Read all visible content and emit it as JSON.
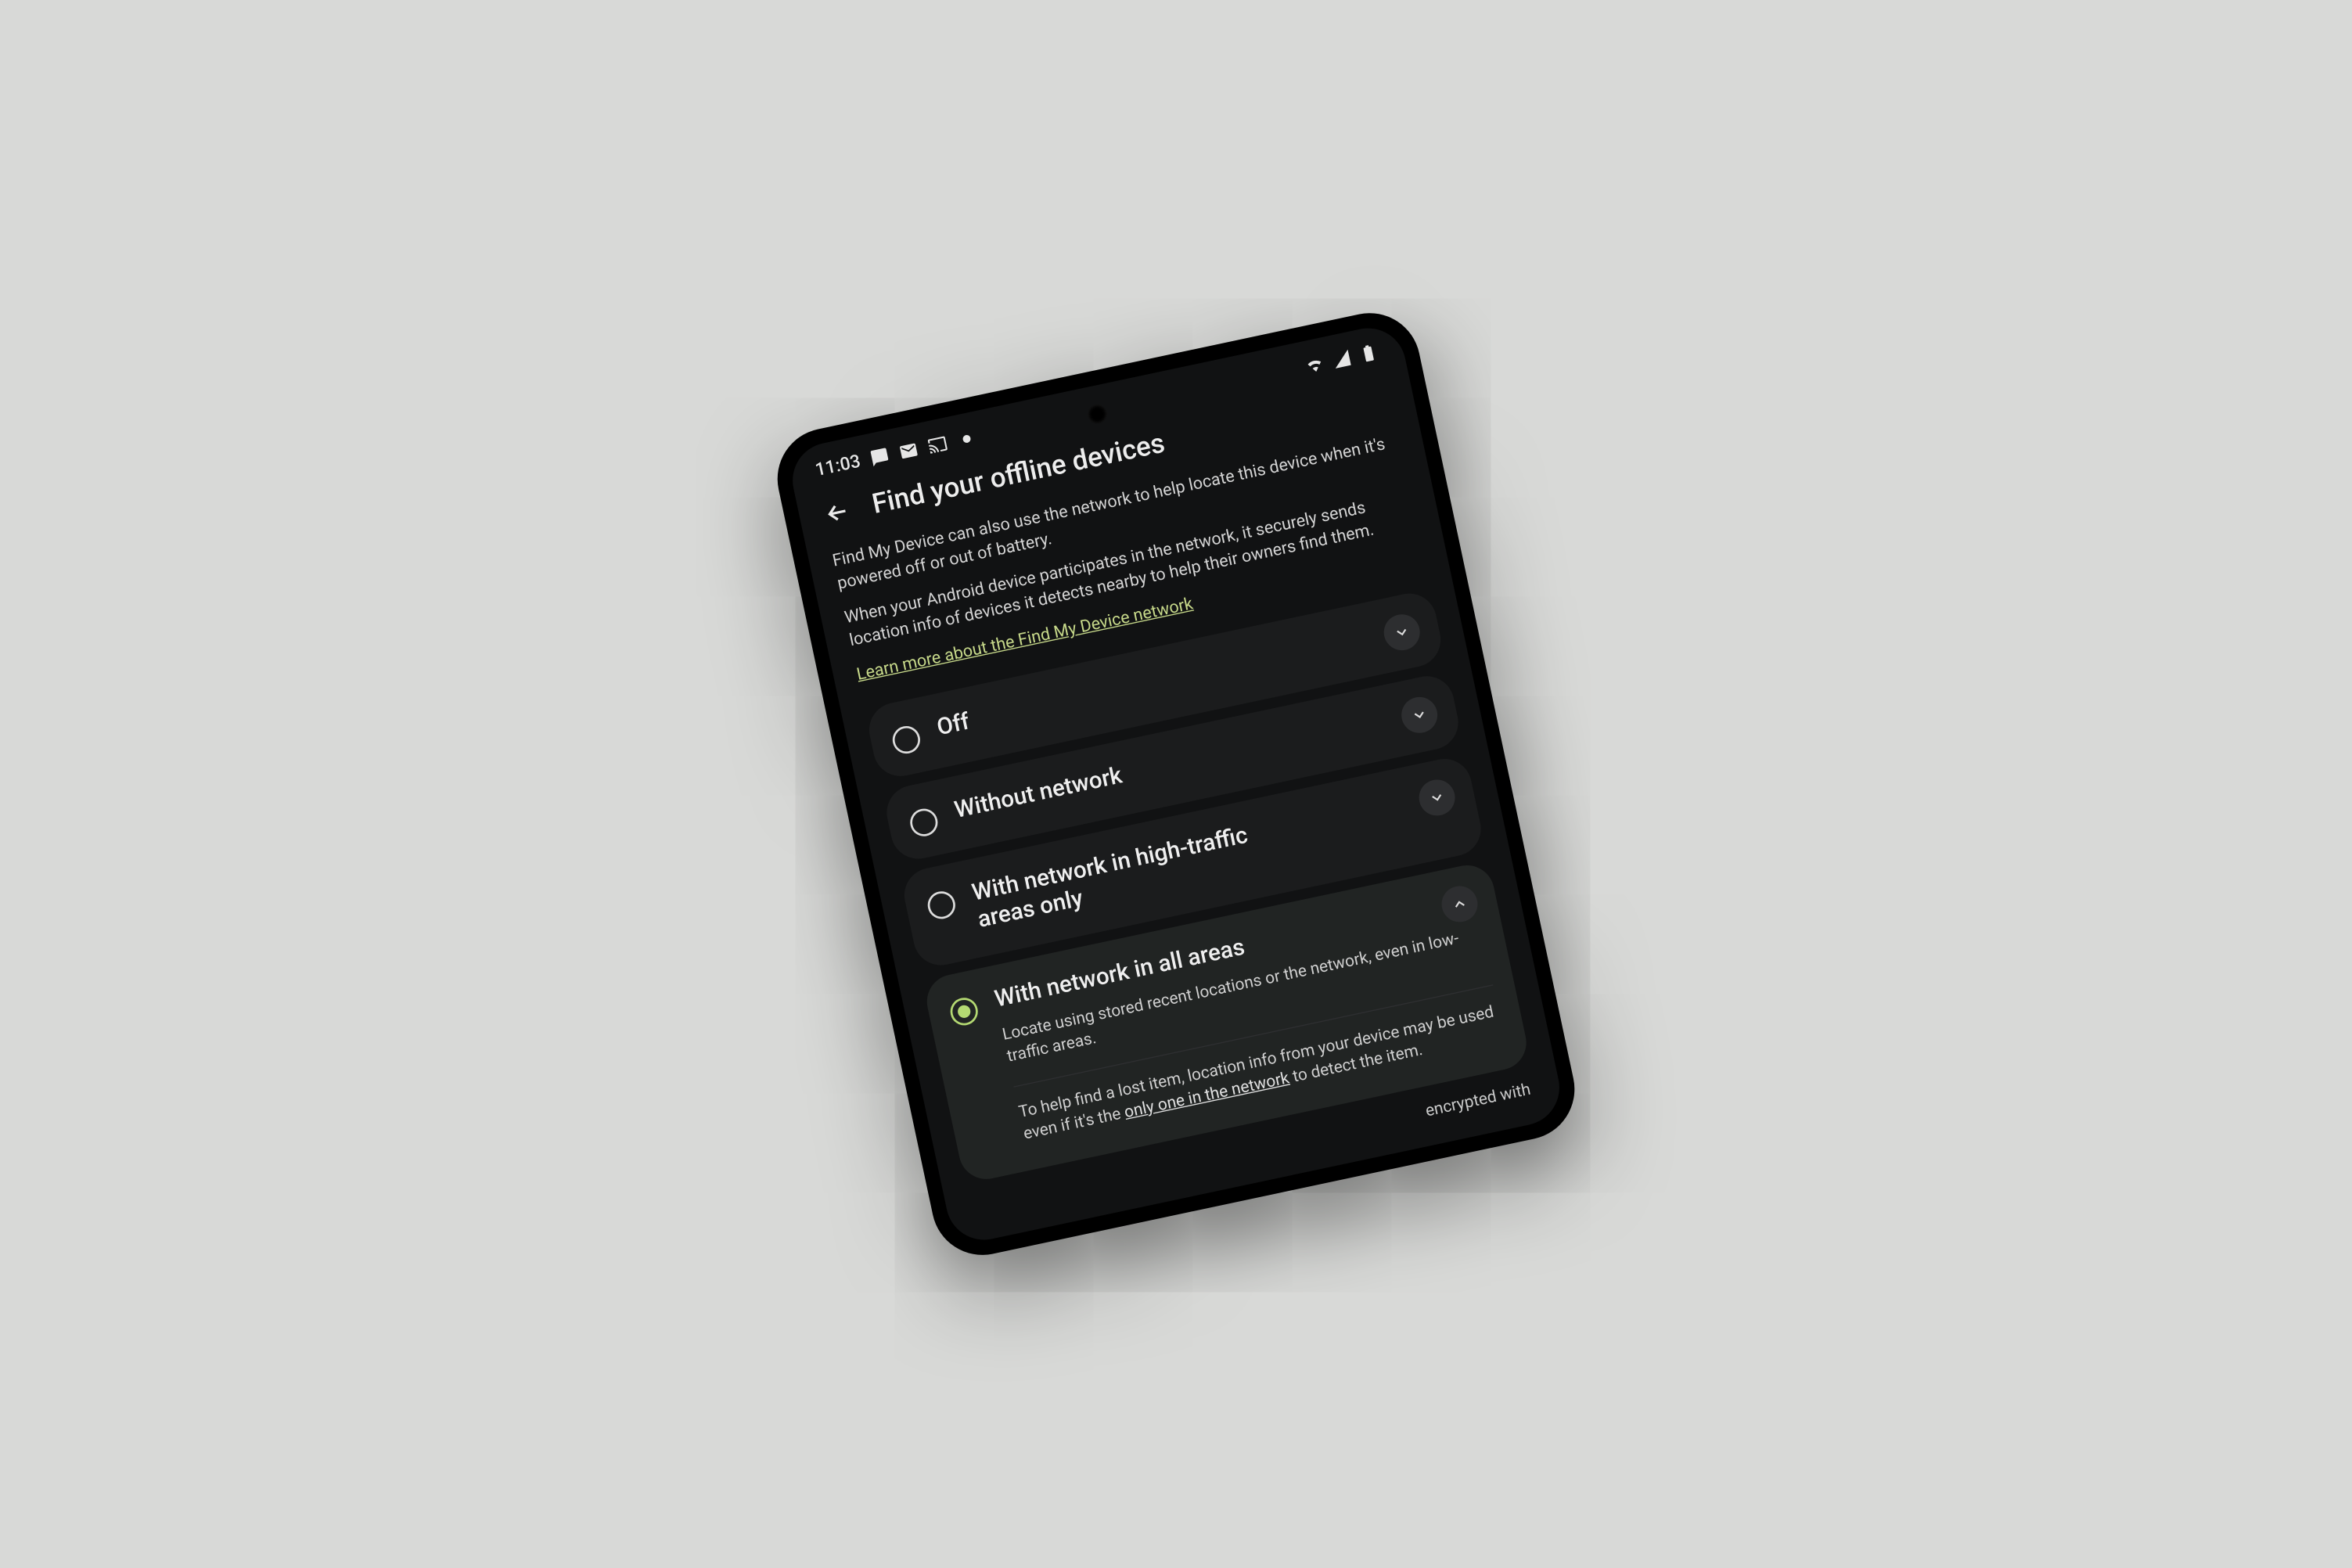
{
  "statusbar": {
    "time": "11:03",
    "icons": [
      "chat",
      "gmail",
      "cast",
      "more"
    ]
  },
  "header": {
    "title": "Find your offline devices"
  },
  "intro": {
    "p1": "Find My Device can also use the network to help locate this device when it's powered off or out of battery.",
    "p2": "When your Android device participates in the network, it securely sends location info of devices it detects nearby to help their owners find them.",
    "learn_more": "Learn more about the Find My Device network"
  },
  "options": [
    {
      "title": "Off",
      "expanded": false,
      "selected": false
    },
    {
      "title": "Without network",
      "expanded": false,
      "selected": false
    },
    {
      "title": "With network in high-traffic areas only",
      "expanded": false,
      "selected": false
    },
    {
      "title": "With network in all areas",
      "expanded": true,
      "selected": true,
      "sub1": "Locate using stored recent locations or the network, even in low-traffic areas.",
      "sub2_a": "To help find a lost item, location info from your device may be used even if it's the ",
      "sub2_link": "only one in the network",
      "sub2_b": " to detect the item."
    }
  ],
  "footer_cut": "encrypted with"
}
